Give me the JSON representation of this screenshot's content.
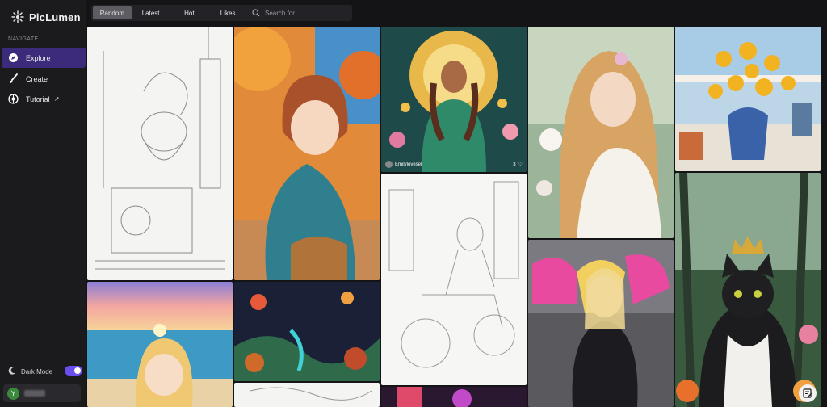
{
  "app": {
    "name": "PicLumen"
  },
  "sidebar": {
    "heading": "NAVIGATE",
    "items": [
      {
        "label": "Explore",
        "icon": "compass-icon"
      },
      {
        "label": "Create",
        "icon": "brush-icon"
      },
      {
        "label": "Tutorial",
        "icon": "tutorial-icon",
        "external": "↗"
      }
    ],
    "dark_mode_label": "Dark Mode",
    "dark_mode_on": true,
    "user_initial": "Y"
  },
  "topbar": {
    "tabs": [
      "Random",
      "Latest",
      "Hot",
      "Likes"
    ],
    "active_tab": "Random",
    "search_placeholder": "Search for"
  },
  "gallery": {
    "card_user": "Emilylovesel",
    "card_likes": "3"
  },
  "colors": {
    "accent": "#6b4ef0",
    "active_nav": "#3c2a7a"
  }
}
